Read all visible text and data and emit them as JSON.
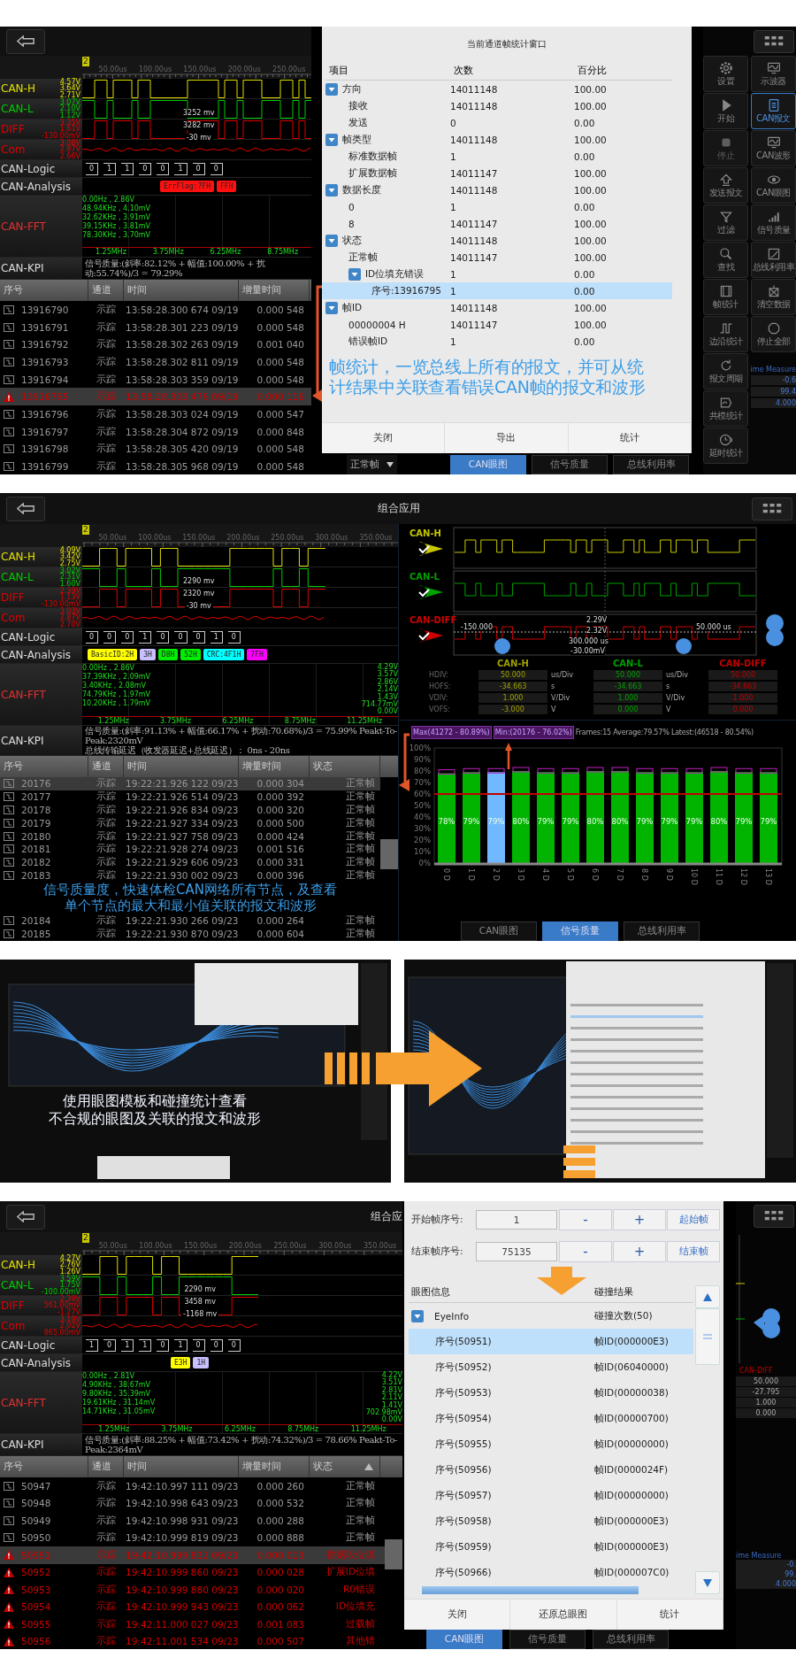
{
  "frame_stats_screen": {
    "scope": {
      "marker": "2",
      "time_ticks": [
        "50.00us",
        "100.00us",
        "150.00us",
        "200.00us",
        "250.00us"
      ],
      "channels": [
        {
          "name": "CAN-H",
          "color": "#e0e000",
          "scale": [
            "4.57V",
            "3.64V",
            "2.71V"
          ]
        },
        {
          "name": "CAN-L",
          "color": "#00cc00",
          "scale": [
            "3.07V",
            "2.10V",
            "1.12V"
          ]
        },
        {
          "name": "DIFF",
          "color": "#e00000",
          "scale": [
            "3.35V",
            "1.61V",
            "-130.00mV"
          ]
        },
        {
          "name": "Com",
          "color": "#e00000",
          "scale": [
            "3.08V",
            "2.87V",
            "2.66V"
          ]
        }
      ],
      "cursor_readings": [
        "3252 mv",
        "3282 mv",
        "-30 mv"
      ],
      "logic_label": "CAN-Logic",
      "logic_bits": [
        "0",
        "1",
        "1",
        "0",
        "0",
        "1",
        "0",
        "0"
      ],
      "analysis_label": "CAN-Analysis",
      "analysis_segments": [
        {
          "text": "ErrFlag:7FH",
          "color": "#ff1010"
        },
        {
          "text": "FFH",
          "color": "#ff1010"
        }
      ],
      "fft_label": "CAN-FFT",
      "fft_peaks": [
        "0.00Hz , 2.86V",
        "48.94KHz , 4.10mV",
        "32.62KHz , 3.91mV",
        "39.15KHz , 3.81mV",
        "78.30KHz , 3.70mV"
      ],
      "fft_freqs": [
        "1.25MHz",
        "3.75MHz",
        "6.25MHz",
        "8.75MHz"
      ],
      "kpi_label": "CAN-KPI",
      "kpi_lines": [
        "信号质量:(斜率:82.12% + 幅值:100.00% + 扰动:55.74%)/3 = 79.29%"
      ]
    },
    "table": {
      "columns": [
        "序号",
        "通道",
        "时间",
        "增量时间"
      ],
      "rows": [
        {
          "kind": "normal",
          "selected": false,
          "cells": [
            "13916790",
            "示踪",
            "13:58:28.300 674 09/19",
            "0.000 548"
          ]
        },
        {
          "kind": "normal",
          "selected": false,
          "cells": [
            "13916791",
            "示踪",
            "13:58:28.301 223 09/19",
            "0.000 548"
          ]
        },
        {
          "kind": "normal",
          "selected": false,
          "cells": [
            "13916792",
            "示踪",
            "13:58:28.302 263 09/19",
            "0.001 040"
          ]
        },
        {
          "kind": "normal",
          "selected": false,
          "cells": [
            "13916793",
            "示踪",
            "13:58:28.302 811 09/19",
            "0.000 548"
          ]
        },
        {
          "kind": "normal",
          "selected": false,
          "cells": [
            "13916794",
            "示踪",
            "13:58:28.303 359 09/19",
            "0.000 548"
          ]
        },
        {
          "kind": "error",
          "selected": true,
          "cells": [
            "13916795",
            "示踪",
            "13:58:28.303 476 09/19",
            "0.000 116"
          ]
        },
        {
          "kind": "normal",
          "selected": false,
          "cells": [
            "13916796",
            "示踪",
            "13:58:28.303 024 09/19",
            "0.000 547"
          ]
        },
        {
          "kind": "normal",
          "selected": false,
          "cells": [
            "13916797",
            "示踪",
            "13:58:28.304 872 09/19",
            "0.000 848"
          ]
        },
        {
          "kind": "normal",
          "selected": false,
          "cells": [
            "13916798",
            "示踪",
            "13:58:28.305 420 09/19",
            "0.000 548"
          ]
        },
        {
          "kind": "normal",
          "selected": false,
          "cells": [
            "13916799",
            "示踪",
            "13:58:28.305 968 09/19",
            "0.000 548"
          ]
        }
      ]
    },
    "dialog": {
      "title": "当前通道帧统计窗口",
      "columns": [
        "项目",
        "次数",
        "百分比"
      ],
      "tree": [
        {
          "label": "方向",
          "count": "14011148",
          "percent": "100.00",
          "expanded": true,
          "selected": false,
          "children": [
            {
              "label": "接收",
              "count": "14011148",
              "percent": "100.00",
              "selected": false
            },
            {
              "label": "发送",
              "count": "0",
              "percent": "0.00",
              "selected": false
            }
          ]
        },
        {
          "label": "帧类型",
          "count": "14011148",
          "percent": "100.00",
          "expanded": true,
          "selected": false,
          "children": [
            {
              "label": "标准数据帧",
              "count": "1",
              "percent": "0.00",
              "selected": false
            },
            {
              "label": "扩展数据帧",
              "count": "14011147",
              "percent": "100.00",
              "selected": false
            }
          ]
        },
        {
          "label": "数据长度",
          "count": "14011148",
          "percent": "100.00",
          "expanded": true,
          "selected": false,
          "children": [
            {
              "label": "0",
              "count": "1",
              "percent": "0.00",
              "selected": false
            },
            {
              "label": "8",
              "count": "14011147",
              "percent": "100.00",
              "selected": false
            }
          ]
        },
        {
          "label": "状态",
          "count": "14011148",
          "percent": "100.00",
          "expanded": true,
          "selected": false,
          "children": [
            {
              "label": "正常帧",
              "count": "14011147",
              "percent": "100.00",
              "selected": false
            },
            {
              "label": "ID位填充错误",
              "count": "1",
              "percent": "0.00",
              "expanded": true,
              "selected": false,
              "children": [
                {
                  "label": "序号:13916795",
                  "count": "1",
                  "percent": "0.00",
                  "selected": true
                }
              ]
            }
          ]
        },
        {
          "label": "帧ID",
          "count": "14011148",
          "percent": "100.00",
          "expanded": true,
          "selected": false,
          "children": [
            {
              "label": "00000004 H",
              "count": "14011147",
              "percent": "100.00",
              "selected": false
            },
            {
              "label": "错误帧ID",
              "count": "1",
              "percent": "0.00",
              "selected": false
            }
          ]
        }
      ],
      "caption_lines": [
        "帧统计，一览总线上所有的报文，并可从统",
        "计结果中关联查看错误CAN帧的报文和波形"
      ],
      "buttons": [
        "关闭",
        "导出",
        "统计"
      ]
    },
    "status_dropdown": "正常帧",
    "bottom_tabs": [
      {
        "label": "CAN眼图",
        "selected": true
      },
      {
        "label": "信号质量",
        "selected": false
      },
      {
        "label": "总线利用率",
        "selected": false
      }
    ],
    "toolbar": {
      "left_tools": [
        {
          "label": "设置",
          "selected": false,
          "disabled": false
        },
        {
          "label": "开始",
          "selected": false,
          "disabled": false
        },
        {
          "label": "停止",
          "selected": false,
          "disabled": true
        },
        {
          "label": "发送报文",
          "selected": false,
          "disabled": false
        },
        {
          "label": "过滤",
          "selected": false,
          "disabled": false
        },
        {
          "label": "查找",
          "selected": false,
          "disabled": false
        },
        {
          "label": "帧统计",
          "selected": false,
          "disabled": false
        },
        {
          "label": "边沿统计",
          "selected": false,
          "disabled": false
        },
        {
          "label": "报文周期",
          "selected": false,
          "disabled": false
        },
        {
          "label": "共模统计",
          "selected": false,
          "disabled": false
        },
        {
          "label": "延时统计",
          "selected": false,
          "disabled": false
        }
      ],
      "right_tools": [
        {
          "label": "示波器",
          "selected": false,
          "disabled": false
        },
        {
          "label": "CAN报文",
          "selected": true,
          "disabled": false
        },
        {
          "label": "CAN波形",
          "selected": false,
          "disabled": false
        },
        {
          "label": "CAN眼图",
          "selected": false,
          "disabled": false
        },
        {
          "label": "信号质量",
          "selected": false,
          "disabled": false
        },
        {
          "label": "总线利用率",
          "selected": false,
          "disabled": false
        },
        {
          "label": "清空数据",
          "selected": false,
          "disabled": false
        },
        {
          "label": "停止全部",
          "selected": false,
          "disabled": false
        }
      ],
      "measure_title": "ime Measure",
      "measure_values": [
        "-0.6",
        "99.4",
        "4.000"
      ]
    }
  },
  "signal_quality_screen": {
    "title": "组合应用",
    "scope": {
      "marker": "2",
      "time_ticks": [
        "50.00us",
        "100.00us",
        "150.00us",
        "200.00us",
        "250.00us",
        "300.00us",
        "350.00us"
      ],
      "channels": [
        {
          "name": "CAN-H",
          "color": "#e0e000",
          "scale": [
            "4.09V",
            "3.42V",
            "2.75V"
          ]
        },
        {
          "name": "CAN-L",
          "color": "#00cc00",
          "scale": [
            "3.02V",
            "2.31V",
            "1.60V"
          ]
        },
        {
          "name": "DIFF",
          "color": "#e00000",
          "scale": [
            "2.39V",
            "1.13V",
            "-130.00mV"
          ]
        },
        {
          "name": "Com",
          "color": "#e00000",
          "scale": [
            "3.03V",
            "2.87V",
            "2.70V"
          ]
        }
      ],
      "cursor_readings": [
        "2290 mv",
        "2320 mv",
        "-30 mv"
      ],
      "logic_label": "CAN-Logic",
      "logic_bits": [
        "0",
        "0",
        "0",
        "1",
        "0",
        "0",
        "0",
        "1",
        "0"
      ],
      "analysis_label": "CAN-Analysis",
      "analysis_segments": [
        {
          "text": "BasicID:2H",
          "color": "#ffff00"
        },
        {
          "text": "3H",
          "color": "#c8c0ff"
        },
        {
          "text": "D8H",
          "color": "#00ee00"
        },
        {
          "text": "52H",
          "color": "#00ee00"
        },
        {
          "text": "CRC:4F1H",
          "color": "#00ffff"
        },
        {
          "text": "7FH",
          "color": "#ff00ff"
        }
      ],
      "fft_label": "CAN-FFT",
      "fft_peaks": [
        "0.00Hz , 2.86V",
        "37.39KHz , 2.09mV",
        "3.40KHz , 2.08mV",
        "74.79KHz , 1.97mV",
        "10.20KHz , 1.79mV"
      ],
      "fft_scale": [
        "4.29V",
        "3.57V",
        "2.86V",
        "2.14V",
        "1.43V",
        "714.77mV",
        "0.00V"
      ],
      "fft_freqs": [
        "1.25MHz",
        "3.75MHz",
        "6.25MHz",
        "8.75MHz",
        "11.25MHz"
      ],
      "kpi_label": "CAN-KPI",
      "kpi_lines": [
        "信号质量:(斜率:91.13% + 幅值:66.17% + 扰动:70.68%)/3 = 75.99%  Peakt-To-Peak:2320mV",
        "总线传输延迟（收发器延迟+总线延迟）： 0ns - 20ns"
      ]
    },
    "table": {
      "columns": [
        "序号",
        "通道",
        "时间",
        "增量时间",
        "状态"
      ],
      "rows": [
        {
          "kind": "normal",
          "selected": true,
          "cells": [
            "20176",
            "示踪",
            "19:22:21.926 122 09/23",
            "0.000 304",
            "正常帧"
          ]
        },
        {
          "kind": "normal",
          "selected": false,
          "cells": [
            "20177",
            "示踪",
            "19:22:21.926 514 09/23",
            "0.000 392",
            "正常帧"
          ]
        },
        {
          "kind": "normal",
          "selected": false,
          "cells": [
            "20178",
            "示踪",
            "19:22:21.926 834 09/23",
            "0.000 320",
            "正常帧"
          ]
        },
        {
          "kind": "normal",
          "selected": false,
          "cells": [
            "20179",
            "示踪",
            "19:22:21.927 334 09/23",
            "0.000 500",
            "正常帧"
          ]
        },
        {
          "kind": "normal",
          "selected": false,
          "cells": [
            "20180",
            "示踪",
            "19:22:21.927 758 09/23",
            "0.000 424",
            "正常帧"
          ]
        },
        {
          "kind": "normal",
          "selected": false,
          "cells": [
            "20181",
            "示踪",
            "19:22:21.928 274 09/23",
            "0.001 516",
            "正常帧"
          ]
        },
        {
          "kind": "normal",
          "selected": false,
          "cells": [
            "20182",
            "示踪",
            "19:22:21.929 606 09/23",
            "0.000 331",
            "正常帧"
          ]
        },
        {
          "kind": "normal",
          "selected": false,
          "cells": [
            "20183",
            "示踪",
            "19:22:21.930 002 09/23",
            "0.000 396",
            "正常帧"
          ]
        },
        {
          "kind": "normal",
          "selected": false,
          "cells": [
            "20184",
            "示踪",
            "19:22:21.930 266 09/23",
            "0.000 264",
            "正常帧"
          ]
        },
        {
          "kind": "normal",
          "selected": false,
          "cells": [
            "20185",
            "示踪",
            "19:22:21.930 870 09/23",
            "0.000 604",
            "正常帧"
          ]
        }
      ]
    },
    "plots": {
      "channels": [
        {
          "name": "CAN-H",
          "color": "#c8c800"
        },
        {
          "name": "CAN-L",
          "color": "#00a000"
        },
        {
          "name": "CAN-DIFF",
          "color": "#d00000"
        }
      ],
      "readings": [
        "2.29V",
        "2.32V",
        "300.000 us",
        "-30.00mV",
        "-150.000",
        "50.000 us"
      ]
    },
    "measure_table": {
      "channels": [
        {
          "name": "CAN-H",
          "color": "#a0a000"
        },
        {
          "name": "CAN-L",
          "color": "#00a000"
        },
        {
          "name": "CAN-DIFF",
          "color": "#c00000"
        }
      ],
      "rows": [
        {
          "label": "HDIV:",
          "cells": [
            {
              "value": "50.000",
              "unit": "us/Div"
            },
            {
              "value": "50.000",
              "unit": "us/Div"
            },
            {
              "value": "50.000"
            }
          ]
        },
        {
          "label": "HOFS:",
          "cells": [
            {
              "value": "-34.663",
              "unit": "s"
            },
            {
              "value": "-34.663",
              "unit": "s"
            },
            {
              "value": "-34.663"
            }
          ]
        },
        {
          "label": "VDIV:",
          "cells": [
            {
              "value": "1.000",
              "unit": "V/Div"
            },
            {
              "value": "1.000",
              "unit": "V/Div"
            },
            {
              "value": "1.000"
            }
          ]
        },
        {
          "label": "VOFS:",
          "cells": [
            {
              "value": "-3.000",
              "unit": "V"
            },
            {
              "value": "0.000",
              "unit": "V"
            },
            {
              "value": "0.000"
            }
          ]
        }
      ]
    },
    "stats": {
      "max": "Max(41272 - 80.89%)",
      "min": "Min:(20176 - 76.02%)",
      "summary": "Frames:15 Average:79.57% Latest:(46518 - 80.54%)"
    },
    "chart_data": {
      "type": "bar",
      "categories": [
        "0 D",
        "1 D",
        "2 D",
        "3 D",
        "4 D",
        "5 D",
        "6 D",
        "7 D",
        "8 D",
        "9 D",
        "10 D",
        "11 D",
        "12 D",
        "13 D"
      ],
      "stacked": true,
      "series": [
        {
          "color": "#00b400",
          "values": [
            78,
            79,
            null,
            80,
            79,
            79,
            80,
            80,
            79,
            79,
            79,
            80,
            79,
            79
          ]
        },
        {
          "color": "#70b8ff",
          "values": [
            null,
            null,
            79,
            null,
            null,
            null,
            null,
            null,
            null,
            null,
            null,
            null,
            null,
            null
          ]
        }
      ],
      "ylim": [
        0,
        100
      ],
      "yticks": [
        {
          "value": 0,
          "label": "0%"
        },
        {
          "value": 10,
          "label": "10%"
        },
        {
          "value": 20,
          "label": "20%"
        },
        {
          "value": 30,
          "label": "30%"
        },
        {
          "value": 40,
          "label": "40%"
        },
        {
          "value": 50,
          "label": "50%"
        },
        {
          "value": 60,
          "label": "60%"
        },
        {
          "value": 70,
          "label": "70%"
        },
        {
          "value": 80,
          "label": "80%"
        },
        {
          "value": 90,
          "label": "90%"
        },
        {
          "value": 100,
          "label": "100%"
        }
      ],
      "value_labels": [
        "78%",
        "79%",
        "79%",
        "80%",
        "79%",
        "79%",
        "80%",
        "80%",
        "79%",
        "79%",
        "79%",
        "80%",
        "79%",
        "79%"
      ]
    },
    "bottom_tabs": [
      {
        "label": "CAN眼图",
        "selected": false
      },
      {
        "label": "信号质量",
        "selected": true
      },
      {
        "label": "总线利用率",
        "selected": false
      }
    ],
    "caption_lines": [
      "信号质量度，快速体检CAN网络所有节点，及查看",
      "单个节点的最大和最小值关联的报文和波形"
    ]
  },
  "eye_template_screens": {
    "caption_lines": [
      "使用眼图模板和碰撞统计查看",
      "不合规的眼图及关联的报文和波形"
    ]
  },
  "eye_collision_screen": {
    "title": "组合应",
    "scope": {
      "marker": "2",
      "time_ticks": [
        "50.00us",
        "100.00us",
        "150.00us",
        "200.00us",
        "250.00us",
        "300.00us",
        "350.00us"
      ],
      "channels": [
        {
          "name": "CAN-H",
          "color": "#e0e000",
          "scale": [
            "4.27V",
            "2.76V",
            "1.26V"
          ]
        },
        {
          "name": "CAN-L",
          "color": "#00cc00",
          "scale": [
            "3.59V",
            "1.75V",
            "-100.00mV"
          ]
        },
        {
          "name": "DIFF",
          "color": "#e00000",
          "scale": [
            "2.39V",
            "561.00mV",
            "-1.27V"
          ]
        },
        {
          "name": "Com",
          "color": "#e00000",
          "scale": [
            "3.19V",
            "2.02V",
            "865.00mV"
          ]
        }
      ],
      "cursor_readings": [
        "2290 mv",
        "3458 mv",
        "-1168 mv"
      ],
      "logic_label": "CAN-Logic",
      "logic_bits": [
        "1",
        "0",
        "1",
        "1",
        "0",
        "1",
        "0",
        "0",
        "0"
      ],
      "analysis_label": "CAN-Analysis",
      "analysis_segments": [
        {
          "text": "E3H",
          "color": "#ffff00"
        },
        {
          "text": "1H",
          "color": "#c8c0ff"
        }
      ],
      "fft_label": "CAN-FFT",
      "fft_peaks": [
        "0.00Hz , 2.81V",
        "4.90KHz , 38.67mV",
        "9.80KHz , 35.39mV",
        "19.61KHz , 31.14mV",
        "14.71KHz , 31.05mV"
      ],
      "fft_scale": [
        "4.22V",
        "3.51V",
        "2.81V",
        "2.11V",
        "1.41V",
        "702.98mV",
        "0.00V"
      ],
      "fft_freqs": [
        "1.25MHz",
        "3.75MHz",
        "6.25MHz",
        "8.75MHz",
        "11.25MHz"
      ],
      "kpi_label": "CAN-KPI",
      "kpi_lines": [
        "信号质量:(斜率:88.25% + 幅值:73.42% + 扰动:74.32%)/3 = 78.66%  Peakt-To-Peak:2364mV"
      ]
    },
    "table": {
      "columns": [
        "序号",
        "通道",
        "时间",
        "增量时间",
        "状态"
      ],
      "rows": [
        {
          "kind": "normal",
          "selected": false,
          "cells": [
            "50947",
            "示踪",
            "19:42:10.997 111 09/23",
            "0.000 260",
            "正常帧"
          ]
        },
        {
          "kind": "normal",
          "selected": false,
          "cells": [
            "50948",
            "示踪",
            "19:42:10.998 643 09/23",
            "0.000 532",
            "正常帧"
          ]
        },
        {
          "kind": "normal",
          "selected": false,
          "cells": [
            "50949",
            "示踪",
            "19:42:10.998 931 09/23",
            "0.000 288",
            "正常帧"
          ]
        },
        {
          "kind": "normal",
          "selected": false,
          "cells": [
            "50950",
            "示踪",
            "19:42:10.999 819 09/23",
            "0.000 888",
            "正常帧"
          ]
        },
        {
          "kind": "error",
          "selected": true,
          "cells": [
            "50951",
            "示踪",
            "19:42:10.999 832 09/23",
            "0.000 013",
            "数据段位填"
          ]
        },
        {
          "kind": "error",
          "selected": false,
          "cells": [
            "50952",
            "示踪",
            "19:42:10.999 860 09/23",
            "0.000 028",
            "扩展ID位填"
          ]
        },
        {
          "kind": "error",
          "selected": false,
          "cells": [
            "50953",
            "示踪",
            "19:42:10.999 880 09/23",
            "0.000 020",
            "R0错误"
          ]
        },
        {
          "kind": "error",
          "selected": false,
          "cells": [
            "50954",
            "示踪",
            "19:42:10.999 943 09/23",
            "0.000 062",
            "ID位填充"
          ]
        },
        {
          "kind": "error",
          "selected": false,
          "cells": [
            "50955",
            "示踪",
            "19:42:11.000 027 09/23",
            "0.001 083",
            "过载帧"
          ]
        },
        {
          "kind": "error",
          "selected": false,
          "cells": [
            "50956",
            "示踪",
            "19:42:11.001 534 09/23",
            "0.000 507",
            "其他错"
          ]
        }
      ]
    },
    "dialog": {
      "fields": [
        {
          "label": "开始帧序号:",
          "value": "1",
          "minus": "-",
          "plus": "+",
          "button": "起始帧"
        },
        {
          "label": "结束帧序号:",
          "value": "75135",
          "minus": "-",
          "plus": "+",
          "button": "结束帧"
        }
      ],
      "columns": [
        "眼图信息",
        "碰撞结果"
      ],
      "root": {
        "label": "EyeInfo",
        "result": "碰撞次数(50)",
        "expanded": true,
        "selected": false,
        "children": [
          {
            "label": "序号(50951)",
            "result": "帧ID(000000E3)",
            "selected": true
          },
          {
            "label": "序号(50952)",
            "result": "帧ID(06040000)",
            "selected": false
          },
          {
            "label": "序号(50953)",
            "result": "帧ID(00000038)",
            "selected": false
          },
          {
            "label": "序号(50954)",
            "result": "帧ID(00000700)",
            "selected": false
          },
          {
            "label": "序号(50955)",
            "result": "帧ID(00000000)",
            "selected": false
          },
          {
            "label": "序号(50956)",
            "result": "帧ID(0000024F)",
            "selected": false
          },
          {
            "label": "序号(50957)",
            "result": "帧ID(00000000)",
            "selected": false
          },
          {
            "label": "序号(50958)",
            "result": "帧ID(000000E3)",
            "selected": false
          },
          {
            "label": "序号(50959)",
            "result": "帧ID(000000E3)",
            "selected": false
          },
          {
            "label": "序号(50966)",
            "result": "帧ID(000007C0)",
            "selected": false
          }
        ]
      },
      "buttons": [
        "关闭",
        "还原总眼图",
        "统计"
      ]
    },
    "bottom_tabs": [
      {
        "label": "CAN眼图",
        "selected": true
      },
      {
        "label": "信号质量",
        "selected": false
      },
      {
        "label": "总线利用率",
        "selected": false
      }
    ],
    "side": {
      "channel": "CAN-DIFF",
      "values": [
        "50.000",
        "-27.795",
        "1.000",
        "0.000"
      ],
      "measure_title": "ime Measure",
      "measure_values": [
        "-0.",
        "99.",
        "4.000"
      ]
    }
  }
}
